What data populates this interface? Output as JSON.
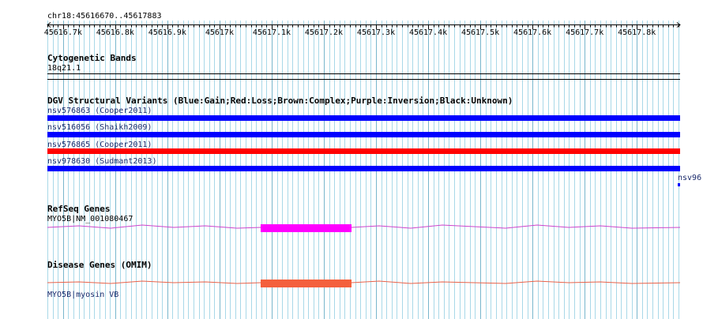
{
  "location": "chr18:45616670..45617883",
  "ruler": {
    "start": 45616670,
    "end": 45617883,
    "ticks": [
      "45616.7k",
      "45616.8k",
      "45616.9k",
      "45617k",
      "45617.1k",
      "45617.2k",
      "45617.3k",
      "45617.4k",
      "45617.5k",
      "45617.6k",
      "45617.7k",
      "45617.8k"
    ]
  },
  "tracks": {
    "cytoband": {
      "title": "Cytogenetic Bands",
      "band": "18q21.1"
    },
    "dgv": {
      "title": "DGV Structural Variants (Blue:Gain;Red:Loss;Brown:Complex;Purple:Inversion;Black:Unknown)",
      "features": [
        {
          "label": "nsv576863 (Cooper2011)",
          "color": "#0000ff"
        },
        {
          "label": "nsv516056 (Shaikh2009)",
          "color": "#0000ff"
        },
        {
          "label": "nsv576865 (Cooper2011)",
          "color": "#ff0000"
        },
        {
          "label": "nsv978630 (Sudmant2013)",
          "color": "#0000ff"
        }
      ],
      "offscreen_label": "nsv96"
    },
    "refseq": {
      "title": "RefSeq Genes",
      "label": "MYO5B|NM_001080467",
      "color": "#ff00ff"
    },
    "disease": {
      "title": "Disease Genes (OMIM)",
      "label": "MYO5B|myosin VB",
      "color": "#f4603d"
    }
  },
  "colors": {
    "grid_minor": "#a8d8e8",
    "grid_major": "#78b6cc"
  }
}
